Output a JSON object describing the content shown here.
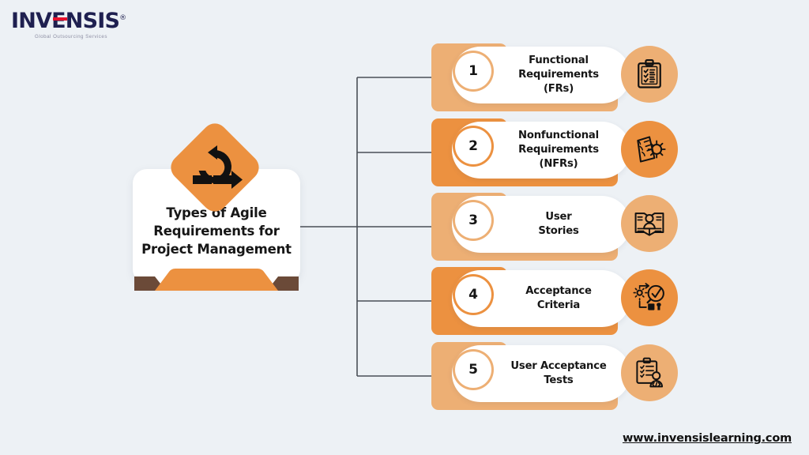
{
  "brand": {
    "logo_text": "INVENSIS",
    "logo_registered": "®",
    "tagline": "Global Outsourcing Services",
    "logo_navy": "#1f2050",
    "logo_red": "#e8112d"
  },
  "theme": {
    "background": "#edf1f5",
    "orange_light": "#edaf74",
    "orange_dark": "#ec9140",
    "ribbon_fold": "#6b4a38",
    "text_dark": "#161616",
    "connector_line": "#4a4f57"
  },
  "center": {
    "title": "Types of Agile\nRequirements for\nProject Management",
    "icon": "agile-sprint-cycle-icon"
  },
  "items": [
    {
      "number": "1",
      "label": "Functional\nRequirements\n(FRs)",
      "icon": "clipboard-checklist-icon",
      "tone": "light"
    },
    {
      "number": "2",
      "label": "Nonfunctional\nRequirements\n(NFRs)",
      "icon": "notepad-gear-icon",
      "tone": "dark"
    },
    {
      "number": "3",
      "label": "User\nStories",
      "icon": "open-book-user-icon",
      "tone": "light"
    },
    {
      "number": "4",
      "label": "Acceptance\nCriteria",
      "icon": "gear-checkmark-magnifier-icon",
      "tone": "dark"
    },
    {
      "number": "5",
      "label": "User Acceptance\nTests",
      "icon": "clipboard-user-code-icon",
      "tone": "light"
    }
  ],
  "footer": {
    "url": "www.invensislearning.com"
  }
}
